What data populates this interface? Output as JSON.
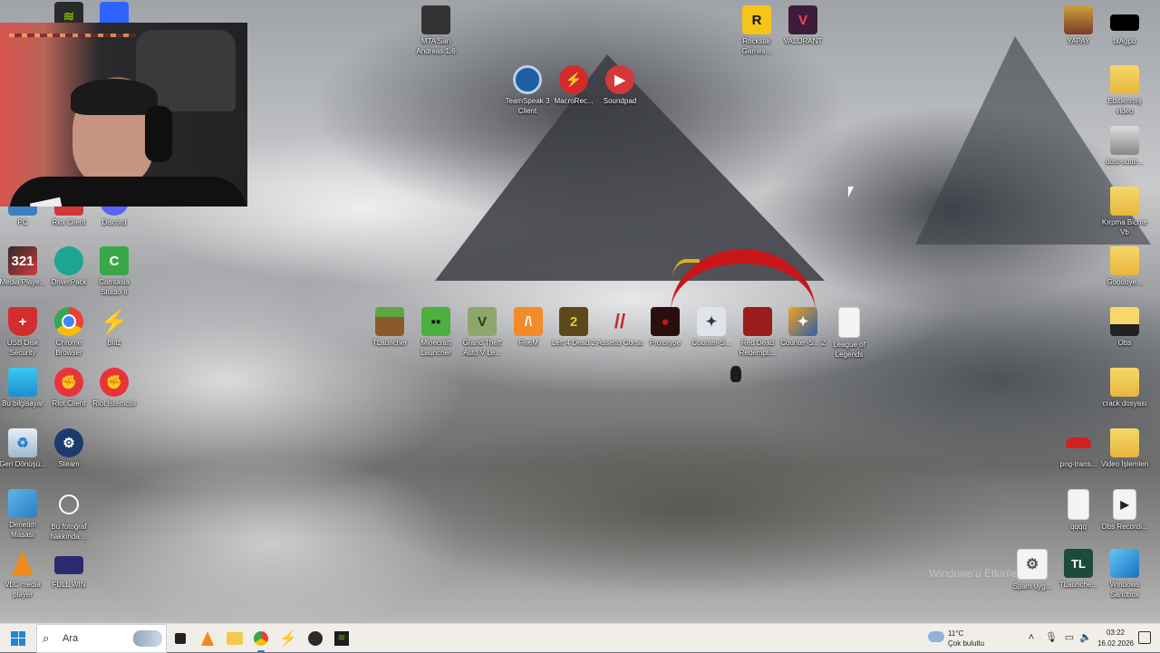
{
  "desktop": {
    "icons": [
      {
        "key": "pc",
        "label": "PC",
        "icon": "computer-icon"
      },
      {
        "key": "riot-client-top",
        "label": "Riot Client",
        "icon": "riot-icon"
      },
      {
        "key": "discord",
        "label": "Discord",
        "icon": "discord-icon"
      },
      {
        "key": "media-player",
        "label": "Media Playe...",
        "icon": "media-player-icon"
      },
      {
        "key": "driverpack",
        "label": "DriverPack",
        "icon": "driverpack-icon"
      },
      {
        "key": "camtasia",
        "label": "Camtasia Studio 8",
        "icon": "camtasia-icon"
      },
      {
        "key": "usb-disk-security",
        "label": "USB Disk Security",
        "icon": "shield-icon"
      },
      {
        "key": "chrome",
        "label": "Chrome Browser",
        "icon": "chrome-icon"
      },
      {
        "key": "blitz",
        "label": "Blitz",
        "icon": "blitz-icon"
      },
      {
        "key": "bu-bilgisayar",
        "label": "Bu bilgisayar",
        "icon": "monitor-icon"
      },
      {
        "key": "riot-client",
        "label": "Riot Client",
        "icon": "riot-icon"
      },
      {
        "key": "riot-istemcisi",
        "label": "Riot İstemcisi",
        "icon": "riot-icon"
      },
      {
        "key": "geri-donusum",
        "label": "Geri Dönüşü...",
        "icon": "recycle-bin-icon"
      },
      {
        "key": "steam",
        "label": "Steam",
        "icon": "steam-icon"
      },
      {
        "key": "denetim-masasi",
        "label": "Denetim Masası",
        "icon": "control-panel-icon"
      },
      {
        "key": "bu-fotograf",
        "label": "Bu fotoğraf hakkında ...",
        "icon": "camera-icon"
      },
      {
        "key": "vlc",
        "label": "VLC media player",
        "icon": "vlc-icon"
      },
      {
        "key": "full-win",
        "label": "FULL WIN",
        "icon": "image-icon"
      },
      {
        "key": "mta",
        "label": "MTA San Andreas 1.6",
        "icon": "mta-icon"
      },
      {
        "key": "teamspeak",
        "label": "TeamSpeak 3 Client",
        "icon": "teamspeak-icon"
      },
      {
        "key": "macrorec",
        "label": "MacroRec...",
        "icon": "macro-icon"
      },
      {
        "key": "soundpad",
        "label": "Soundpad",
        "icon": "soundpad-icon"
      },
      {
        "key": "rockstar",
        "label": "Rockstar Games...",
        "icon": "rockstar-icon"
      },
      {
        "key": "valorant",
        "label": "VALORANT",
        "icon": "valorant-icon"
      },
      {
        "key": "tlauncher",
        "label": "TLauncher",
        "icon": "grass-block-icon"
      },
      {
        "key": "minecraft",
        "label": "Minecraft Launcher",
        "icon": "creeper-icon"
      },
      {
        "key": "gta5",
        "label": "Grand Theft Auto V Le...",
        "icon": "gta-icon"
      },
      {
        "key": "fivem",
        "label": "FiveM",
        "icon": "fivem-icon"
      },
      {
        "key": "l4d2",
        "label": "Left 4 Dead 2",
        "icon": "l4d2-icon"
      },
      {
        "key": "assetto",
        "label": "Assetto Corsa",
        "icon": "assetto-icon"
      },
      {
        "key": "prototype",
        "label": "Prototype",
        "icon": "prototype-icon"
      },
      {
        "key": "cs1",
        "label": "Counter-S...",
        "icon": "counter-strike-icon"
      },
      {
        "key": "rdr",
        "label": "Red Dead Redempti...",
        "icon": "rdr-icon"
      },
      {
        "key": "cs2",
        "label": "Counter-S... 2",
        "icon": "counter-strike-icon"
      },
      {
        "key": "lol",
        "label": "League of Legends",
        "icon": "document-icon"
      },
      {
        "key": "yapay",
        "label": "YAPAY",
        "icon": "folder-icon"
      },
      {
        "key": "txagpb",
        "label": "txAgpb",
        "icon": "black-file-icon"
      },
      {
        "key": "editlenmis",
        "label": "Editlenmiş video",
        "icon": "folder-icon"
      },
      {
        "key": "dost-sutte",
        "label": "dost-sutte...",
        "icon": "image-file-icon"
      },
      {
        "key": "kirpma",
        "label": "Kırpma Biçme Vb",
        "icon": "folder-icon"
      },
      {
        "key": "goodbye",
        "label": "Goodbye...",
        "icon": "folder-icon"
      },
      {
        "key": "obs",
        "label": "Obs",
        "icon": "folder-icon"
      },
      {
        "key": "crack",
        "label": "crack dosyası",
        "icon": "folder-icon"
      },
      {
        "key": "png-trans",
        "label": "png-trans...",
        "icon": "car-icon"
      },
      {
        "key": "video-islemleri",
        "label": "Video İşlemleri",
        "icon": "folder-icon"
      },
      {
        "key": "qqqq",
        "label": "qqqq",
        "icon": "document-icon"
      },
      {
        "key": "obs-record",
        "label": "Obs Recordi...",
        "icon": "play-icon"
      },
      {
        "key": "spam",
        "label": "Spam uyg...",
        "icon": "gear-icon"
      },
      {
        "key": "tlauncher2",
        "label": "TLaunche...",
        "icon": "tlauncher-icon"
      },
      {
        "key": "windows-sandbox",
        "label": "Windows Sandbox",
        "icon": "sandbox-icon"
      }
    ],
    "watermark": "Windows'u Etkinle..."
  },
  "taskbar": {
    "search_placeholder": "Ara",
    "apps": [
      "file-manager",
      "vlc",
      "file-explorer",
      "chrome",
      "blitz",
      "obs",
      "nvidia"
    ],
    "weather_temp": "11°C",
    "weather_condition": "Çok bulutlu",
    "time": "03:22",
    "date": "16.02.2026"
  },
  "colors": {
    "taskbar_bg": "#f1eee9",
    "accent": "#1a88d8",
    "folder": "#f2c94c"
  }
}
